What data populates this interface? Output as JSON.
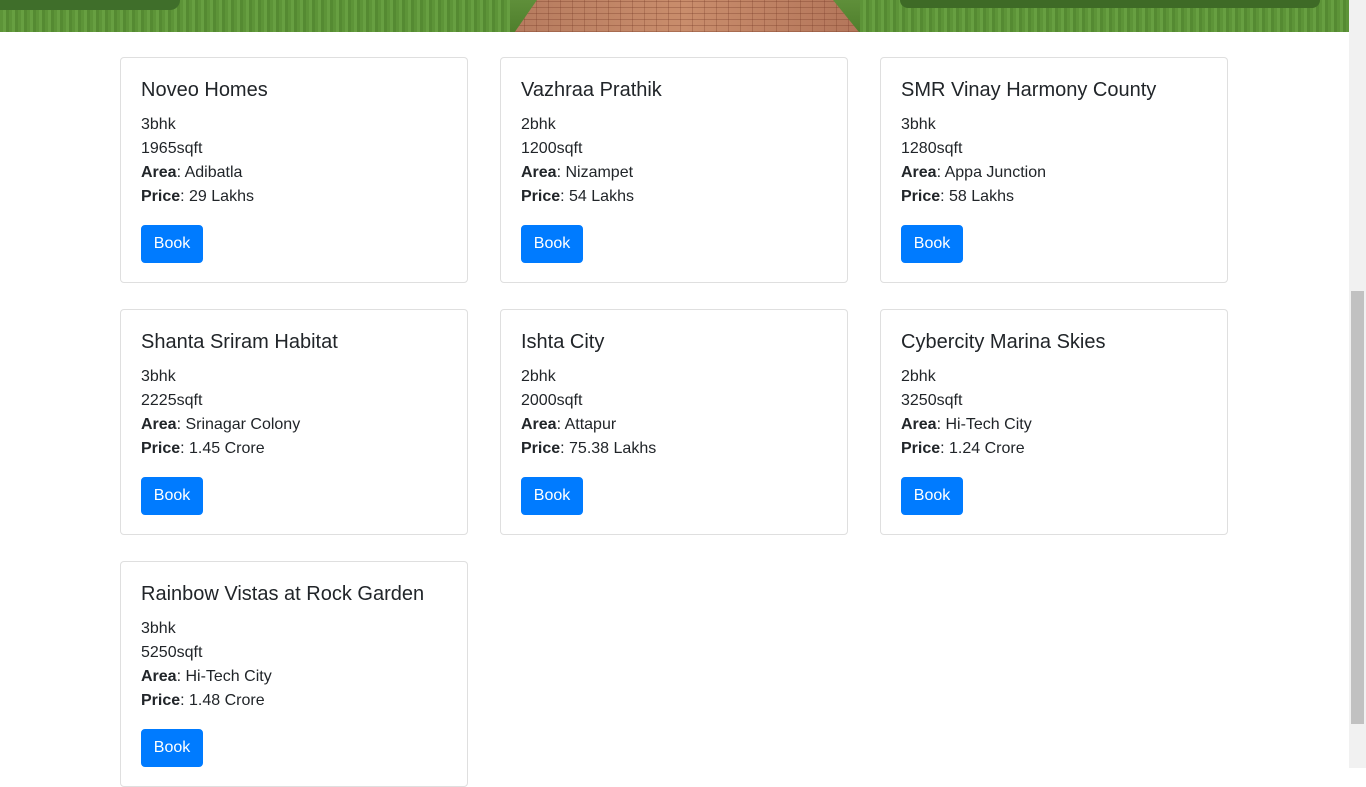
{
  "labels": {
    "area": "Area",
    "price": "Price"
  },
  "cards": [
    {
      "name": "Noveo Homes",
      "bhk": "3bhk",
      "sqft": "1965sqft",
      "area": "Adibatla",
      "price": "29 Lakhs",
      "button": "Book"
    },
    {
      "name": "Vazhraa Prathik",
      "bhk": "2bhk",
      "sqft": "1200sqft",
      "area": "Nizampet",
      "price": "54 Lakhs",
      "button": "Book"
    },
    {
      "name": "SMR Vinay Harmony County",
      "bhk": "3bhk",
      "sqft": "1280sqft",
      "area": "Appa Junction",
      "price": "58 Lakhs",
      "button": "Book"
    },
    {
      "name": "Shanta Sriram Habitat",
      "bhk": "3bhk",
      "sqft": "2225sqft",
      "area": "Srinagar Colony",
      "price": "1.45 Crore",
      "button": "Book"
    },
    {
      "name": "Ishta City",
      "bhk": "2bhk",
      "sqft": "2000sqft",
      "area": "Attapur",
      "price": "75.38 Lakhs",
      "button": "Book"
    },
    {
      "name": "Cybercity Marina Skies",
      "bhk": "2bhk",
      "sqft": "3250sqft",
      "area": "Hi-Tech City",
      "price": "1.24 Crore",
      "button": "Book"
    },
    {
      "name": "Rainbow Vistas at Rock Garden",
      "bhk": "3bhk",
      "sqft": "5250sqft",
      "area": "Hi-Tech City",
      "price": "1.48 Crore",
      "button": "Book"
    }
  ],
  "colors": {
    "primary": "#007bff",
    "text": "#212529",
    "border": "rgba(0,0,0,0.125)"
  }
}
